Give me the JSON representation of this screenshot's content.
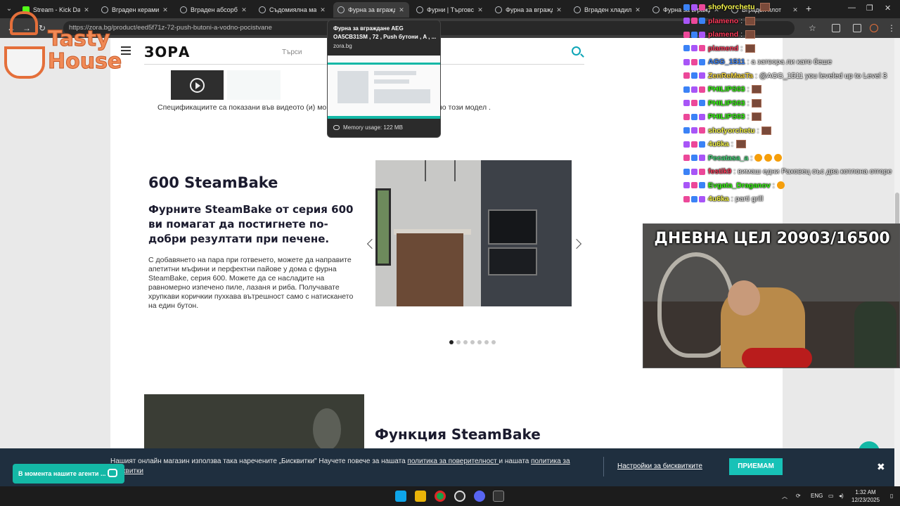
{
  "browser": {
    "tabs": [
      {
        "label": "Stream - Kick Dashb",
        "icon": "kick-icon"
      },
      {
        "label": "Вграден керамичен",
        "icon": "globe-icon"
      },
      {
        "label": "Вграден абсорбато",
        "icon": "globe-icon"
      },
      {
        "label": "Съдомиялна маши",
        "icon": "globe-icon"
      },
      {
        "label": "Фурна за вграждан",
        "icon": "globe-icon",
        "active": true
      },
      {
        "label": "Фурни | Търговска",
        "icon": "globe-icon"
      },
      {
        "label": "Фурна за вграждан",
        "icon": "globe-icon"
      },
      {
        "label": "Вграден хладилник",
        "icon": "globe-icon"
      },
      {
        "label": "Фурна за вграждан",
        "icon": "globe-icon"
      },
      {
        "label": "Вграден плот",
        "icon": "globe-icon"
      }
    ],
    "url": "https://zora.bg/product/eed5f71z-72-push-butoni-a-vodno-pocistvane",
    "tab_preview": {
      "title": "Фурна за вграждане AEG OA5CB31SM , 72 , Push бутони , A , ...",
      "domain": "zora.bg",
      "memory": "Memory usage: 122 MB"
    }
  },
  "site": {
    "logo": "ЗОРА",
    "search_placeholder": "Търси",
    "spec_text": "Спецификациите са показани във видеото (и) мо",
    "spec_tail": "но този модел ."
  },
  "section": {
    "title": "600 SteamBake",
    "subtitle": "Фурните SteamBake от серия 600 ви помагат да постигнете по-добри резултати при печене.",
    "body": "С добавянето на пара при готвенето, можете да направите апетитни мъфини и перфектни пайове у дома с фурна SteamBake, серия 600. Можете да се насладите на равномерно изпечено пиле, лазаня и риба. Получавате хрупкави коричкии пухкава вътрешност само с натискането на един бутон.",
    "carousel_total": 7,
    "carousel_active": 0
  },
  "function_title": "Функция SteamBake",
  "cookie": {
    "text_part1": "Нашият онлайн магазин използва така наречените „Бисквитки\" Научете повече за нашата ",
    "link1": "политика за поверителност ",
    "text_part2": "и нашата ",
    "link2": "политика за Бисквитки",
    "settings": "Настройки за бисквитките",
    "accept": "ПРИЕМАМ",
    "close": "✖"
  },
  "agent_chat": "В момента нашите агенти ...",
  "taskbar": {
    "lang": "ENG",
    "time": "1:32 AM",
    "date": "12/23/2025"
  },
  "overlay": {
    "logo_line1": "Tasty",
    "logo_line2": "House",
    "goal": "ДНЕВНА ЦЕЛ 20903/16500",
    "chat": [
      {
        "user": "shofyorchetu",
        "color": "#f5f54a",
        "msg": "",
        "emote": true
      },
      {
        "user": "plameno",
        "color": "#ff3b5c",
        "msg": ":",
        "emote": true
      },
      {
        "user": "plamend",
        "color": "#ff3b5c",
        "msg": ":",
        "emote": true
      },
      {
        "user": "plamend",
        "color": "#ff3b5c",
        "msg": ":",
        "emote": true
      },
      {
        "user": "AGG_1511",
        "color": "#3b82f6",
        "msg": ": а затвора ли като беше",
        "emote": false
      },
      {
        "user": "ZenReMaaTa",
        "color": "#f5d742",
        "msg": ": @AGG_1511 you leveled up to Level 3",
        "emote": false
      },
      {
        "user": "PHILIPS03",
        "color": "#39ff14",
        "msg": ":",
        "emote": true
      },
      {
        "user": "PHILIPS03",
        "color": "#39ff14",
        "msg": ":",
        "emote": true
      },
      {
        "user": "PHILIPS03",
        "color": "#39ff14",
        "msg": ":",
        "emote": true
      },
      {
        "user": "shofyorchetu",
        "color": "#f5f54a",
        "msg": ":",
        "emote": true
      },
      {
        "user": "4u6ka",
        "color": "#f5f54a",
        "msg": ":",
        "emote": true
      },
      {
        "user": "Pecatasa_a",
        "color": "#4ade80",
        "msg": ":",
        "emote": false,
        "emoji": 3
      },
      {
        "user": "festik9",
        "color": "#ff3b5c",
        "msg": ": вимаш едни Раховец със два котлона отгоре",
        "emote": false
      },
      {
        "user": "Evgata_Draganov",
        "color": "#39ff14",
        "msg": ":",
        "emote": false,
        "emoji": 1
      },
      {
        "user": "4u6ka",
        "color": "#f5f54a",
        "msg": ": parti grill",
        "emote": false
      }
    ]
  },
  "colors": {
    "accent": "#14b8a6",
    "cookie_bg": "#1f2f3f",
    "overlay_orange": "#f08a56"
  }
}
